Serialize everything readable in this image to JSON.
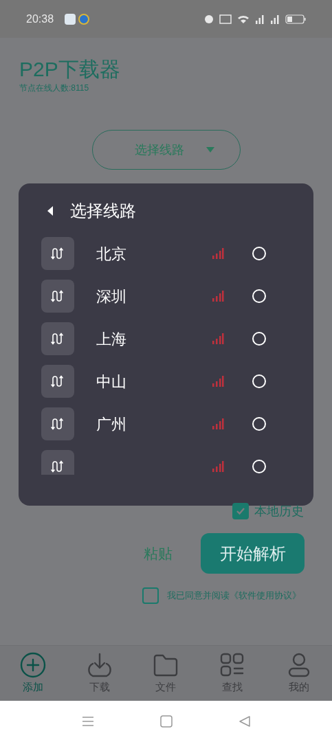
{
  "status_bar": {
    "time": "20:38"
  },
  "header": {
    "title": "P2P下载器",
    "subtitle": "节点在线人数:8115"
  },
  "route_selector": {
    "label": "选择线路"
  },
  "dialog": {
    "title": "选择线路",
    "items": [
      {
        "name": "北京",
        "selected": false
      },
      {
        "name": "深圳",
        "selected": false
      },
      {
        "name": "上海",
        "selected": false
      },
      {
        "name": "中山",
        "selected": false
      },
      {
        "name": "广州",
        "selected": false
      },
      {
        "selected": false
      }
    ]
  },
  "history_option": {
    "label": "本地历史",
    "checked": true
  },
  "paste_button": "粘贴",
  "parse_button": "开始解析",
  "agreement": {
    "label": "我已同意并阅读《软件使用协议》",
    "checked": false
  },
  "nav": [
    {
      "label": "添加",
      "kind": "add",
      "selected": true
    },
    {
      "label": "下载",
      "kind": "download",
      "selected": false
    },
    {
      "label": "文件",
      "kind": "folder",
      "selected": false
    },
    {
      "label": "查找",
      "kind": "grid",
      "selected": false
    },
    {
      "label": "我的",
      "kind": "user",
      "selected": false
    }
  ]
}
